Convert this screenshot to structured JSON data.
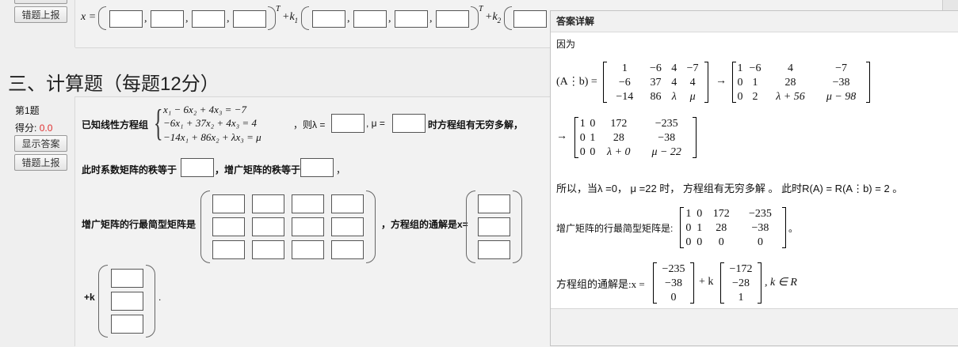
{
  "prev_question": {
    "report_button": "错题上报",
    "formula_prefix": "x =",
    "t_sup": "T",
    "k1": "+k",
    "k1_sub": "1",
    "k2": "+k",
    "k2_sub": "2"
  },
  "section": {
    "title": "三、计算题（每题12分）"
  },
  "question": {
    "number": "第1题",
    "score_label": "得分:",
    "score_value": "0.0",
    "show_answer_button": "显示答案",
    "report_button": "错题上报",
    "intro": "已知线性方程组",
    "eq1": "x₁ − 6x₂ + 4x₃ = −7",
    "eq2": "−6x₁ + 37x₂ + 4x₃ = 4",
    "eq3": "−14x₁ + 86x₂ + λx₃ = μ",
    "then_lambda": "，则λ =",
    "mu_label": ", μ =",
    "condition": "时方程组有无穷多解，",
    "rank_coef": "此时系数矩阵的秩等于",
    "rank_aug": "，增广矩阵的秩等于",
    "rank_end": "，",
    "rref_label": "增广矩阵的行最简型矩阵是",
    "general_label": "，方程组的通解是x=",
    "plus_k": "+k",
    "period": "."
  },
  "panel": {
    "title": "答案详解",
    "because": "因为",
    "ab_label": "(A⋮b) =",
    "arrow": "→",
    "m1": [
      [
        "1",
        "−6",
        "4",
        "−7"
      ],
      [
        "−6",
        "37",
        "4",
        "4"
      ],
      [
        "−14",
        "86",
        "λ",
        "μ"
      ]
    ],
    "m2": [
      [
        "1",
        "−6",
        "4",
        "−7"
      ],
      [
        "0",
        "1",
        "28",
        "−38"
      ],
      [
        "0",
        "2",
        "λ + 56",
        "μ − 98"
      ]
    ],
    "m3": [
      [
        "1",
        "0",
        "172",
        "−235"
      ],
      [
        "0",
        "1",
        "28",
        "−38"
      ],
      [
        "0",
        "0",
        "λ + 0",
        "μ − 22"
      ]
    ],
    "conclusion": "所以，当λ =0， μ =22 时， 方程组有无穷多解 。 此时R(A) = R(A⋮b) = 2 。",
    "rref_label": "增广矩阵的行最简型矩阵是:",
    "rref_end": "。",
    "m4": [
      [
        "1",
        "0",
        "172",
        "−235"
      ],
      [
        "0",
        "1",
        "28",
        "−38"
      ],
      [
        "0",
        "0",
        "0",
        "0"
      ]
    ],
    "general_label": "方程组的通解是:x =",
    "v1": [
      "−235",
      "−38",
      "0"
    ],
    "plus_k": "+ k",
    "v2": [
      "−172",
      "−28",
      "1"
    ],
    "k_in_r": ", k ∈ R"
  }
}
